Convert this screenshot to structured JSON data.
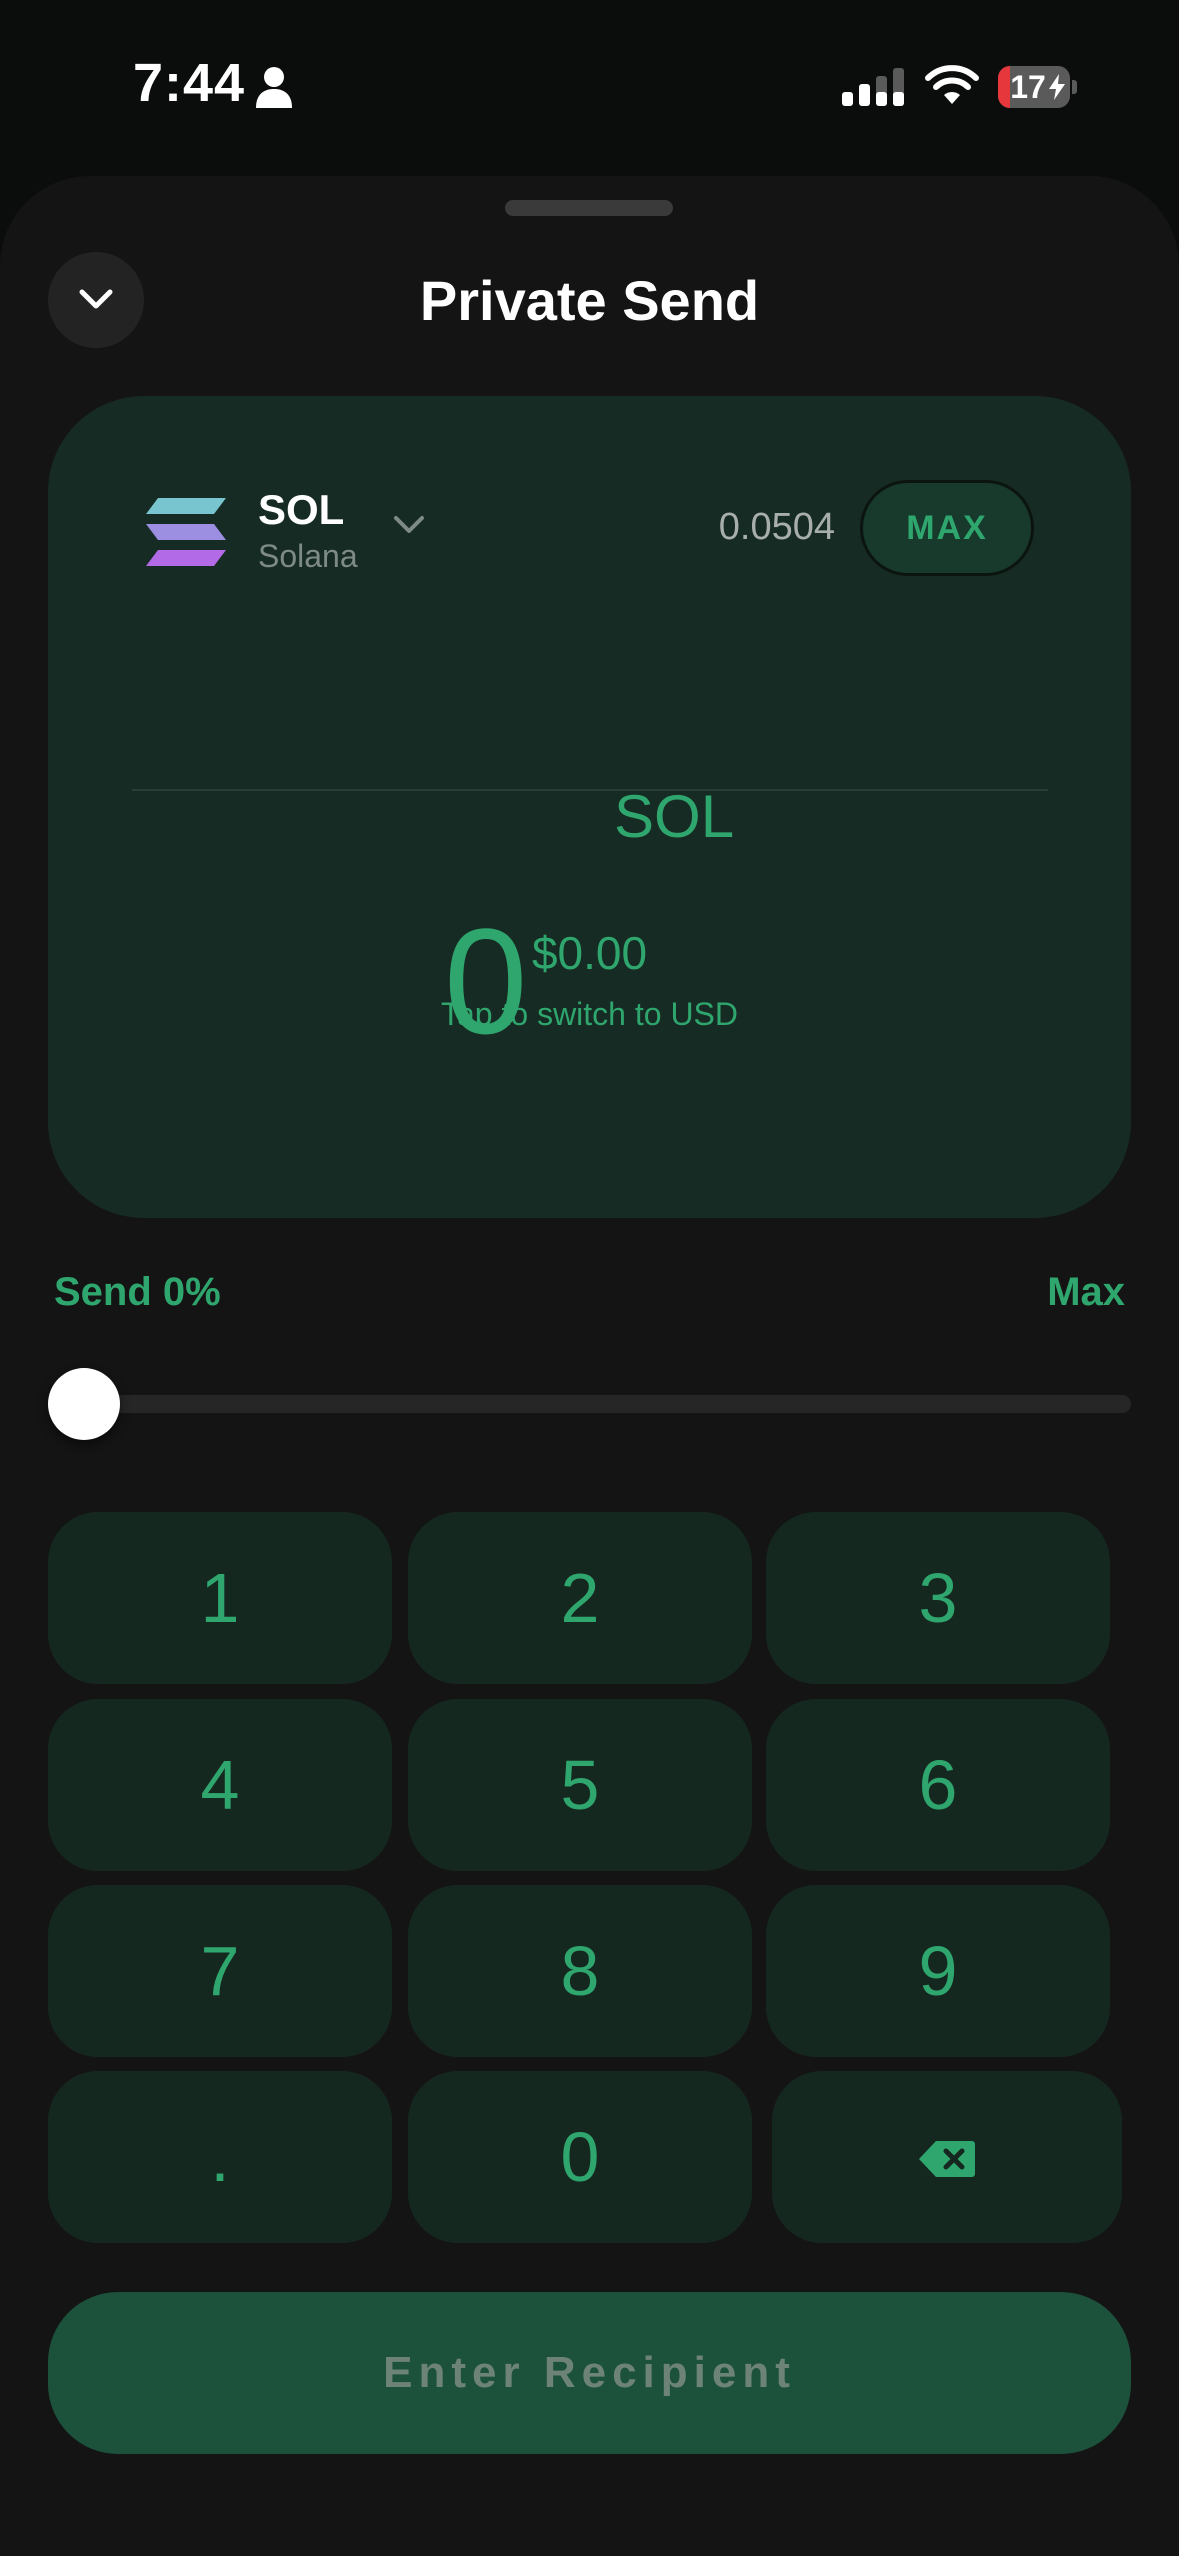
{
  "status_bar": {
    "time": "7:44",
    "battery_level": "17",
    "battery_fraction": 0.17,
    "icons": [
      "person-icon",
      "cellular-signal-icon",
      "wifi-icon",
      "battery-charging-icon"
    ]
  },
  "sheet": {
    "title": "Private Send",
    "close_icon": "chevron-down-icon"
  },
  "token": {
    "symbol": "SOL",
    "name": "Solana",
    "icon": "solana-logo",
    "balance": "0.0504",
    "max_label": "MAX"
  },
  "amount": {
    "value": "0",
    "unit": "SOL",
    "usd_value": "$0.00",
    "switch_hint": "Tap to switch to USD"
  },
  "slider": {
    "label": "Send 0%",
    "max_label": "Max",
    "fraction": 0.0
  },
  "keypad": {
    "keys": [
      "1",
      "2",
      "3",
      "4",
      "5",
      "6",
      "7",
      "8",
      "9",
      ".",
      "0"
    ],
    "backspace_icon": "backspace-icon"
  },
  "cta": {
    "label": "Enter Recipient"
  },
  "colors": {
    "accent": "#2fa66e",
    "card_bg": "#162b23",
    "key_bg": "#142820",
    "cta_bg": "#1c523c",
    "sheet_bg": "#141414"
  }
}
